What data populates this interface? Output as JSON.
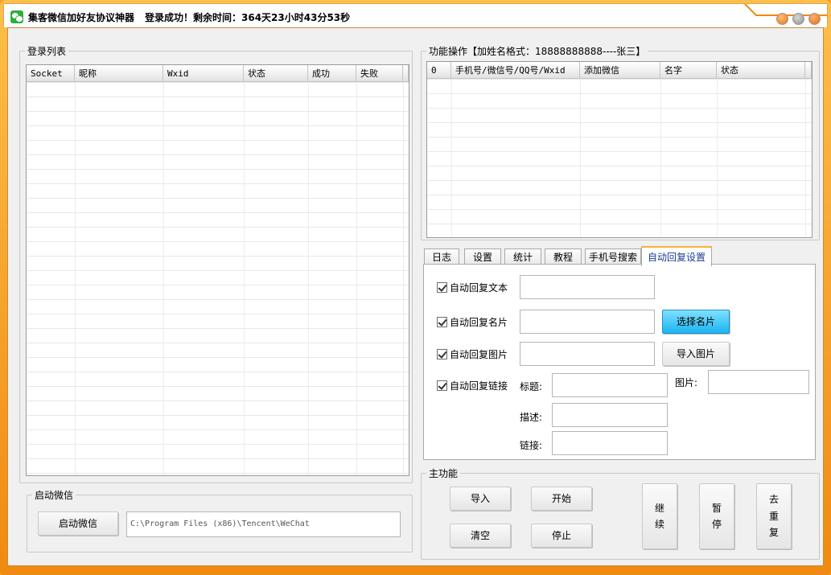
{
  "window": {
    "title": "集客微信加好友协议神器",
    "status": "登录成功！剩余时间：364天23小时43分53秒"
  },
  "login_list": {
    "legend": "登录列表",
    "columns": [
      "Socket",
      "昵称",
      "Wxid",
      "状态",
      "成功",
      "失败"
    ]
  },
  "function_ops": {
    "legend": "功能操作【加姓名格式：18888888888----张三】",
    "columns": [
      "0",
      "手机号/微信号/QQ号/Wxid",
      "添加微信",
      "名字",
      "状态"
    ]
  },
  "tabs": [
    {
      "label": "日志",
      "active": false
    },
    {
      "label": "设置",
      "active": false
    },
    {
      "label": "统计",
      "active": false
    },
    {
      "label": "教程",
      "active": false
    },
    {
      "label": "手机号搜索",
      "active": false
    },
    {
      "label": "自动回复设置",
      "active": true
    }
  ],
  "auto_reply": {
    "text_label": "自动回复文本",
    "card_label": "自动回复名片",
    "image_label": "自动回复图片",
    "link_label": "自动回复链接",
    "choose_card_button": "选择名片",
    "import_image_button": "导入图片",
    "link_title_label": "标题:",
    "link_image_label": "图片:",
    "link_desc_label": "描述:",
    "link_url_label": "链接:"
  },
  "start_wechat": {
    "legend": "启动微信",
    "button": "启动微信",
    "path": "C:\\Program Files (x86)\\Tencent\\WeChat"
  },
  "main_functions": {
    "legend": "主功能",
    "import_button": "导入",
    "start_button": "开始",
    "clear_button": "清空",
    "stop_button": "停止",
    "continue_button": "继续",
    "pause_button": "暂停",
    "dedupe_button": "去重复"
  },
  "colors": {
    "frame": "#f08a10",
    "primary_button": "#1bb5f2",
    "active_tab_text": "#1a3d8f"
  }
}
